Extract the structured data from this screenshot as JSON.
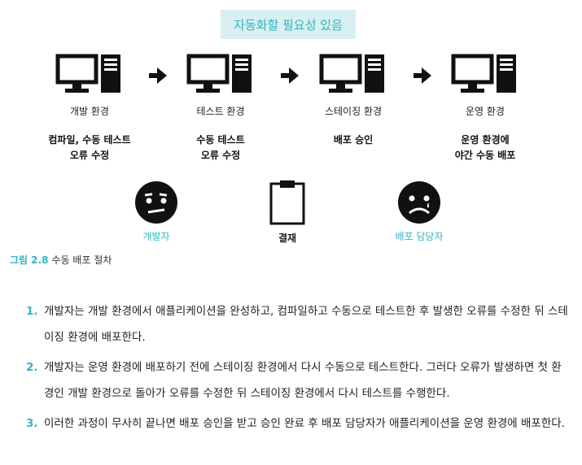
{
  "banner": "자동화할 필요성 있음",
  "environments": [
    {
      "label": "개발 환경",
      "desc_line1": "컴파일, 수동 테스트",
      "desc_line2": "오류 수정"
    },
    {
      "label": "테스트 환경",
      "desc_line1": "수동 테스트",
      "desc_line2": "오류 수정"
    },
    {
      "label": "스테이징 환경",
      "desc_line1": "배포 승인",
      "desc_line2": ""
    },
    {
      "label": "운영 환경",
      "desc_line1": "운영 환경에",
      "desc_line2": "야간 수동 배포"
    }
  ],
  "actors": [
    {
      "label": "개발자",
      "icon": "neutral-face-icon"
    },
    {
      "label": "결재",
      "icon": "clipboard-icon"
    },
    {
      "label": "배포 담당자",
      "icon": "sad-face-icon"
    }
  ],
  "caption": {
    "figure": "그림 2.8",
    "text": "수동 배포 절차"
  },
  "steps": [
    {
      "num": "1.",
      "text": "개발자는 개발 환경에서 애플리케이션을 완성하고, 컴파일하고 수동으로 테스트한 후 발생한 오류를 수정한 뒤 스테이징 환경에 배포한다."
    },
    {
      "num": "2.",
      "text": "개발자는 운영 환경에 배포하기 전에 스테이징 환경에서 다시 수동으로 테스트한다. 그러다 오류가 발생하면 첫 환경인 개발 환경으로 돌아가 오류를 수정한 뒤 스테이징 환경에서 다시 테스트를 수행한다."
    },
    {
      "num": "3.",
      "text": "이러한 과정이 무사히 끝나면 배포 승인을 받고 승인 완료 후 배포 담당자가 애플리케이션을 운영 환경에 배포한다."
    }
  ],
  "colors": {
    "accent": "#2fb5c0",
    "banner_bg": "#d8f0f1"
  }
}
